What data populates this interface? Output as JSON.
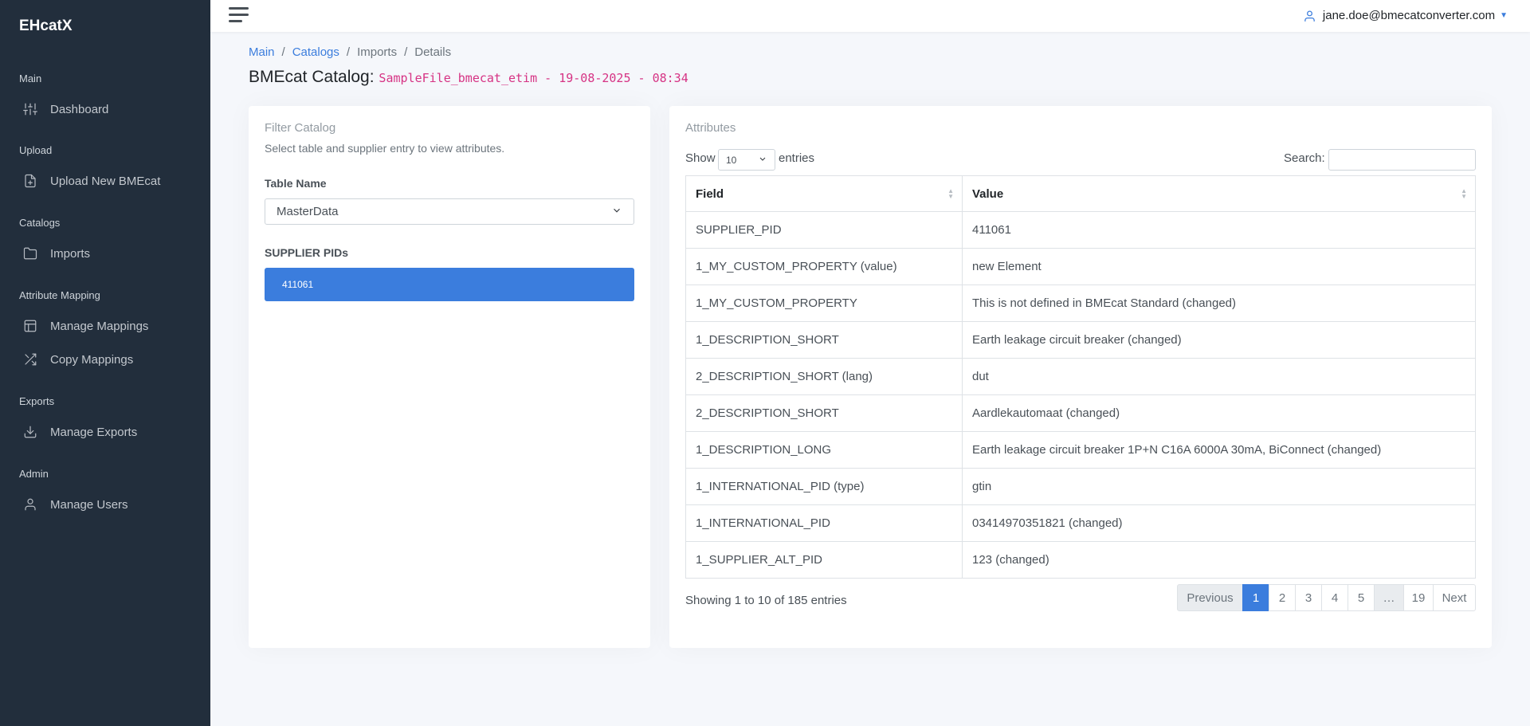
{
  "app": {
    "brand": "EHcatX"
  },
  "sidebar": {
    "sections": [
      {
        "header": "Main",
        "items": [
          {
            "label": "Dashboard",
            "icon": "sliders-icon"
          }
        ]
      },
      {
        "header": "Upload",
        "items": [
          {
            "label": "Upload New BMEcat",
            "icon": "file-plus-icon"
          }
        ]
      },
      {
        "header": "Catalogs",
        "items": [
          {
            "label": "Imports",
            "icon": "folder-icon"
          }
        ]
      },
      {
        "header": "Attribute Mapping",
        "items": [
          {
            "label": "Manage Mappings",
            "icon": "layout-icon"
          },
          {
            "label": "Copy Mappings",
            "icon": "shuffle-icon"
          }
        ]
      },
      {
        "header": "Exports",
        "items": [
          {
            "label": "Manage Exports",
            "icon": "download-icon"
          }
        ]
      },
      {
        "header": "Admin",
        "items": [
          {
            "label": "Manage Users",
            "icon": "user-icon"
          }
        ]
      }
    ]
  },
  "topbar": {
    "user_email": "jane.doe@bmecatconverter.com"
  },
  "breadcrumb": {
    "items": [
      "Main",
      "Catalogs",
      "Imports",
      "Details"
    ]
  },
  "page": {
    "title_prefix": "BMEcat Catalog:",
    "catalog_name": "SampleFile_bmecat_etim - 19-08-2025 - 08:34"
  },
  "filter": {
    "title": "Filter Catalog",
    "subtitle": "Select table and supplier entry to view attributes.",
    "table_label": "Table Name",
    "table_value": "MasterData",
    "pids_label": "SUPPLIER PIDs",
    "pids": [
      "411061"
    ]
  },
  "attributes": {
    "title": "Attributes",
    "show_label": "Show",
    "page_length": "10",
    "entries_label": "entries",
    "search_label": "Search:",
    "search_value": "",
    "columns": [
      "Field",
      "Value"
    ],
    "rows": [
      [
        "SUPPLIER_PID",
        "411061"
      ],
      [
        "1_MY_CUSTOM_PROPERTY (value)",
        "new Element"
      ],
      [
        "1_MY_CUSTOM_PROPERTY",
        "This is not defined in BMEcat Standard (changed)"
      ],
      [
        "1_DESCRIPTION_SHORT",
        "Earth leakage circuit breaker (changed)"
      ],
      [
        "2_DESCRIPTION_SHORT (lang)",
        "dut"
      ],
      [
        "2_DESCRIPTION_SHORT",
        "Aardlekautomaat (changed)"
      ],
      [
        "1_DESCRIPTION_LONG",
        "Earth leakage circuit breaker 1P+N C16A 6000A 30mA, BiConnect (changed)"
      ],
      [
        "1_INTERNATIONAL_PID (type)",
        "gtin"
      ],
      [
        "1_INTERNATIONAL_PID",
        "03414970351821 (changed)"
      ],
      [
        "1_SUPPLIER_ALT_PID",
        "123 (changed)"
      ]
    ],
    "info": "Showing 1 to 10 of 185 entries",
    "pagination": {
      "previous": "Previous",
      "pages": [
        "1",
        "2",
        "3",
        "4",
        "5",
        "…",
        "19"
      ],
      "next": "Next",
      "active_page": "1"
    }
  },
  "colors": {
    "sidebar_bg": "#222e3c",
    "primary": "#3b7ddd",
    "code_pink": "#d63384",
    "page_bg": "#f5f7fb"
  }
}
